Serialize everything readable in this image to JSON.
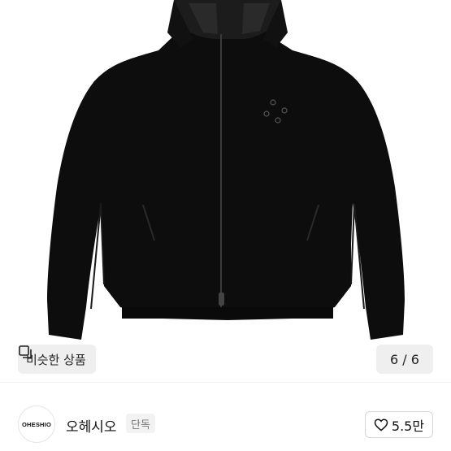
{
  "product": {
    "image_description_icon": "jacket-photo"
  },
  "gallery": {
    "similar_label": "비슷한 상품",
    "counter": "6 / 6"
  },
  "seller": {
    "avatar_text": "OHESHIO",
    "name": "오헤시오",
    "badge": "단독"
  },
  "like": {
    "count": "5.5만"
  },
  "colors": {
    "jacket": "#0d0d0d",
    "chip_bg": "#eeeeee",
    "text": "#222222"
  }
}
